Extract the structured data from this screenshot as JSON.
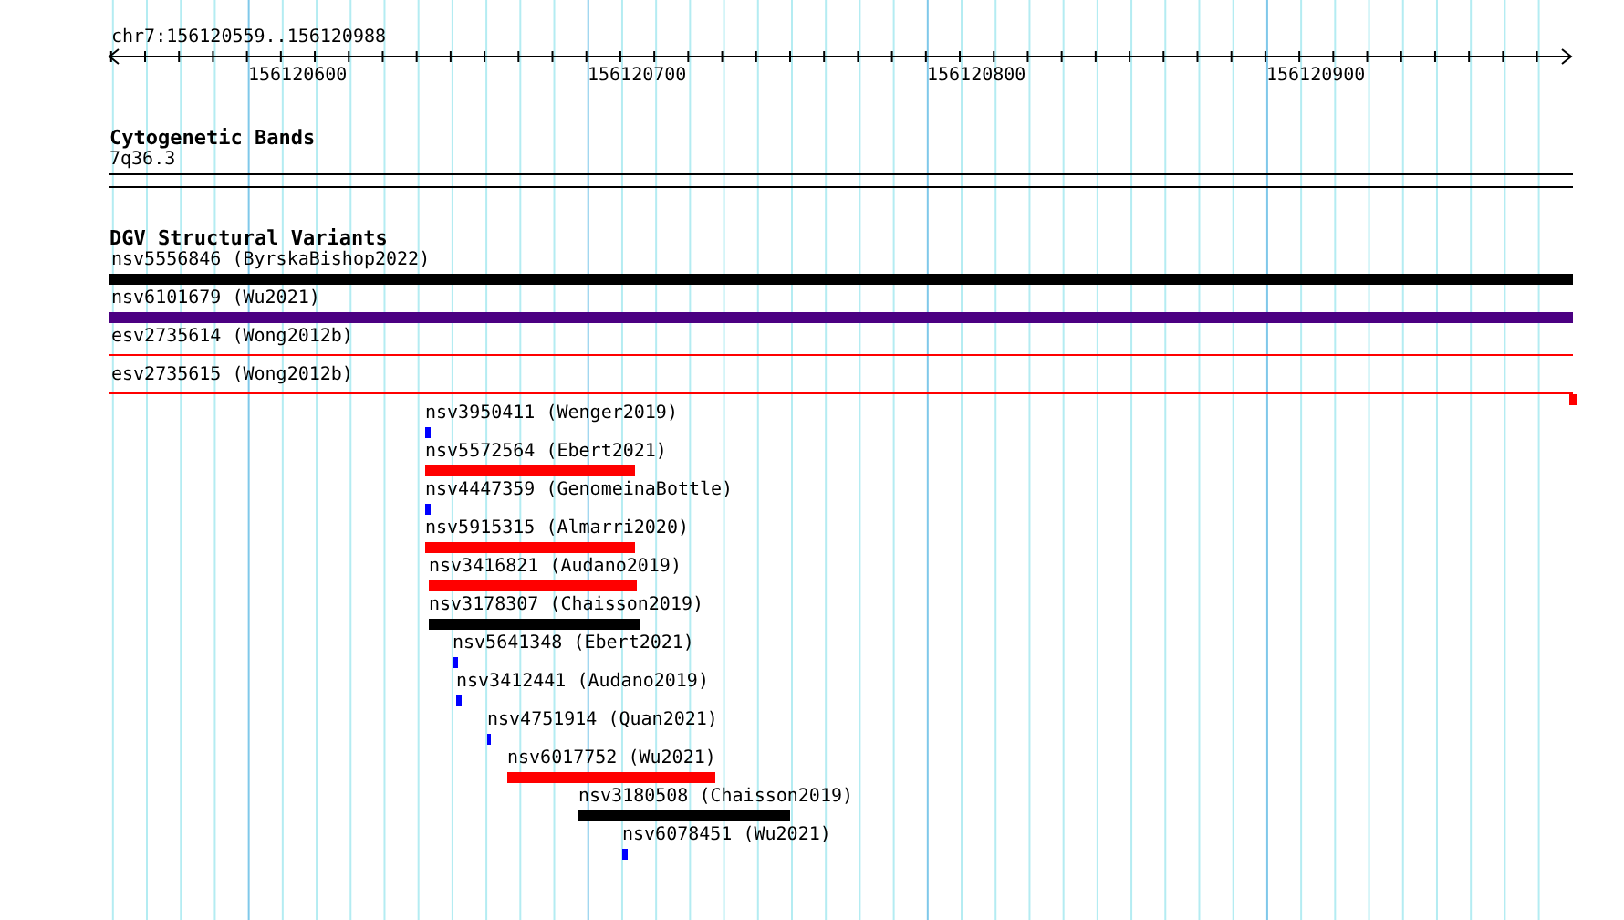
{
  "ruler": {
    "range": "chr7:156120559..156120988",
    "tick_labels": [
      "156120600",
      "156120700",
      "156120800",
      "156120900"
    ]
  },
  "cytogenetic_bands": {
    "title": "Cytogenetic Bands",
    "band": "7q36.3"
  },
  "dgv_track": {
    "title": "DGV Structural Variants",
    "features": [
      {
        "label": "nsv5556846 (ByrskaBishop2022)",
        "kind": "bar",
        "color": "#000000"
      },
      {
        "label": "nsv6101679 (Wu2021)",
        "kind": "bar",
        "color": "#4b0082"
      },
      {
        "label": "esv2735614 (Wong2012b)",
        "kind": "line",
        "color": "#ff0000"
      },
      {
        "label": "esv2735615 (Wong2012b)",
        "kind": "line-end",
        "color": "#ff0000"
      },
      {
        "label": "nsv3950411 (Wenger2019)",
        "kind": "bar",
        "color": "#0000ff"
      },
      {
        "label": "nsv5572564 (Ebert2021)",
        "kind": "bar",
        "color": "#ff0000"
      },
      {
        "label": "nsv4447359 (GenomeinaBottle)",
        "kind": "bar",
        "color": "#0000ff"
      },
      {
        "label": "nsv5915315 (Almarri2020)",
        "kind": "bar",
        "color": "#ff0000"
      },
      {
        "label": "nsv3416821 (Audano2019)",
        "kind": "bar",
        "color": "#ff0000"
      },
      {
        "label": "nsv3178307 (Chaisson2019)",
        "kind": "bar",
        "color": "#000000"
      },
      {
        "label": "nsv5641348 (Ebert2021)",
        "kind": "bar",
        "color": "#0000ff"
      },
      {
        "label": "nsv3412441 (Audano2019)",
        "kind": "bar",
        "color": "#0000ff"
      },
      {
        "label": "nsv4751914 (Quan2021)",
        "kind": "bar",
        "color": "#0000ff"
      },
      {
        "label": "nsv6017752 (Wu2021)",
        "kind": "bar",
        "color": "#ff0000"
      },
      {
        "label": "nsv3180508 (Chaisson2019)",
        "kind": "bar",
        "color": "#000000"
      },
      {
        "label": "nsv6078451 (Wu2021)",
        "kind": "bar",
        "color": "#0000ff"
      }
    ]
  }
}
